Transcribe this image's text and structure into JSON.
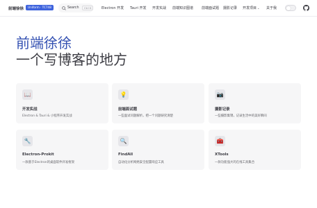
{
  "nav": {
    "brand": "前端徐徐",
    "badge": "Uniform · TC748",
    "search_label": "Search",
    "search_kbd": "Ctrl K",
    "links": [
      "Electron 开发",
      "Tauri 开发",
      "开发实战",
      "前端知识图谱",
      "前端面试题",
      "摄影记录",
      "开发项目",
      "关于我"
    ],
    "dropdown_index": 6
  },
  "hero": {
    "name": "前端徐徐",
    "text": "一个写博客的地方"
  },
  "features": [
    {
      "icon": "book-icon",
      "glyph": "📖",
      "title": "开发实战",
      "desc": "Electron & Tauri & 小程序开发实战"
    },
    {
      "icon": "lightbulb-icon",
      "glyph": "💡",
      "title": "前端面试题",
      "desc": "一些面试问题解析，把一个问题研究清楚"
    },
    {
      "icon": "camera-icon",
      "glyph": "📷",
      "title": "摄影记录",
      "desc": "一些摄影集锦，记录生活中的美好瞬间"
    },
    {
      "icon": "wrench-icon",
      "glyph": "🔧",
      "title": "Electron-Prokit",
      "desc": "一款基于Electron的桌面软件开发框架"
    },
    {
      "icon": "magnifier-icon",
      "glyph": "🔍",
      "title": "FindAll",
      "desc": "自动化分析网络安全配置响应工具"
    },
    {
      "icon": "toolbox-icon",
      "glyph": "🧰",
      "title": "XTools",
      "desc": "一款功能强大的在线工具集合"
    }
  ],
  "colors": {
    "brand": "#3451b2",
    "badge": "#3e63dd",
    "card_bg": "#f6f6f7"
  }
}
